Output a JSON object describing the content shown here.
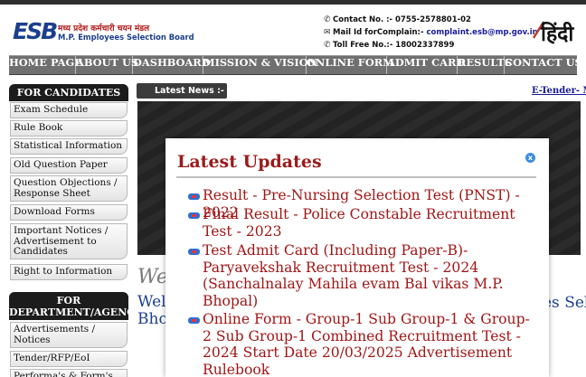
{
  "header": {
    "logo_mark": "ESB",
    "logo_hindi": "मध्य प्रदेश कर्मचारी चयन मंडल",
    "logo_english": "M.P. Employees Selection Board",
    "contact_no": "Contact No. :- 0755-2578801-02",
    "mail_label": "Mail Id forComplain:-",
    "mail_value": "complaint.esb@mp.gov.in",
    "toll_free": "Toll Free No.:- 18002337899",
    "language_toggle": "हिंदी"
  },
  "nav": {
    "items": [
      "HOME PAGE",
      "ABOUT US",
      "DASHBOARD",
      "MISSION & VISION",
      "ONLINE FORM",
      "ADMIT CARD",
      "RESULTS",
      "CONTACT US"
    ]
  },
  "sidebar": {
    "candidates_heading": "FOR CANDIDATES",
    "candidate_items": [
      "Exam Schedule",
      "Rule Book",
      "Statistical Information",
      "Old Question Paper",
      "Question Objections / Response Sheet",
      "Download Forms",
      "Important Notices / Advertisement to Candidates",
      "Right to Information"
    ],
    "department_heading": "FOR DEPARTMENT/AGENCIES",
    "department_items": [
      "Advertisements / Notices",
      "Tender/RFP/EoI",
      "Performa's & Form's"
    ]
  },
  "main": {
    "latest_news_label": "Latest News :-",
    "ticker_text": "E-Tender- M",
    "welcome_script": "We",
    "welcome_line1": "Wel",
    "welcome_line2": "Bho",
    "welcome_right": "es Sel"
  },
  "modal": {
    "title": "Latest Updates",
    "close_symbol": "x",
    "updates": [
      "Result - Pre-Nursing Selection Test (PNST) - 2022",
      "Final Result - Police Constable Recruitment Test - 2023",
      "Test Admit Card  (Including Paper-B)- Paryavekshak Recruitment Test - 2024 (Sanchalnalay Mahila evam Bal vikas M.P. Bhopal)",
      "Online Form - Group-1 Sub Group-1 & Group-2 Sub Group-1 Combined Recruitment Test - 2024 Start Date 20/03/2025  Advertisement  Rulebook"
    ]
  },
  "colors": {
    "nav_bg": "#6f6f6f",
    "accent_red": "#a11616",
    "link_blue": "#1a1a9a",
    "brand_blue": "#1b3f8e"
  }
}
